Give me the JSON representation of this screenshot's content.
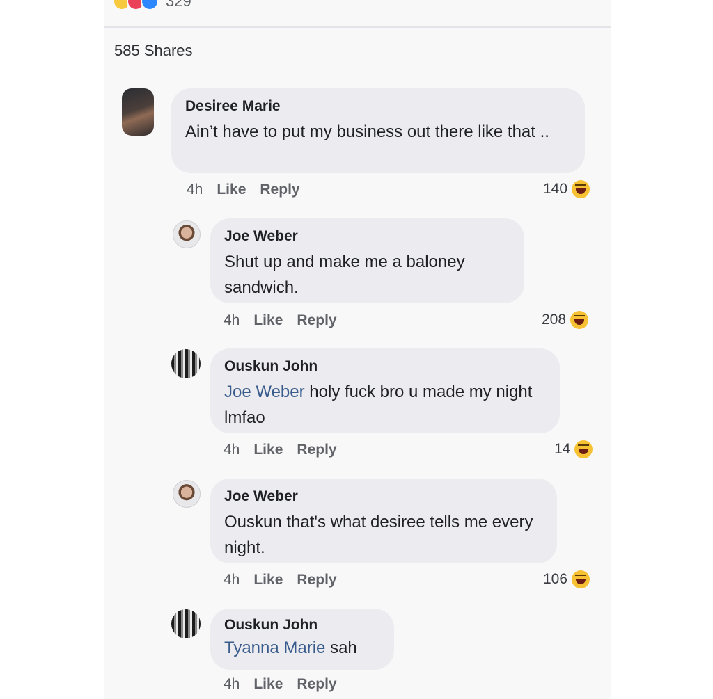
{
  "post": {
    "reaction_count": "329",
    "shares": "585 Shares"
  },
  "comments": [
    {
      "author": "Desiree Marie",
      "text": "Ain’t have to put my business out there like that ..",
      "time": "4h",
      "like": "Like",
      "reply": "Reply",
      "reactions": "140"
    },
    {
      "author": "Joe Weber",
      "text": "Shut up and make me a baloney sandwich.",
      "time": "4h",
      "like": "Like",
      "reply": "Reply",
      "reactions": "208"
    },
    {
      "author": "Ouskun John",
      "mention": "Joe Weber",
      "text": " holy fuck bro u made my night lmfao",
      "time": "4h",
      "like": "Like",
      "reply": "Reply",
      "reactions": "14"
    },
    {
      "author": "Joe Weber",
      "text": "Ouskun that's what desiree tells me every night.",
      "time": "4h",
      "like": "Like",
      "reply": "Reply",
      "reactions": "106"
    },
    {
      "author": "Ouskun John",
      "mention": "Tyanna Marie",
      "text": " sah",
      "time": "4h",
      "like": "Like",
      "reply": "Reply"
    }
  ],
  "icons": {
    "reaction": "haha-emoji-icon"
  }
}
